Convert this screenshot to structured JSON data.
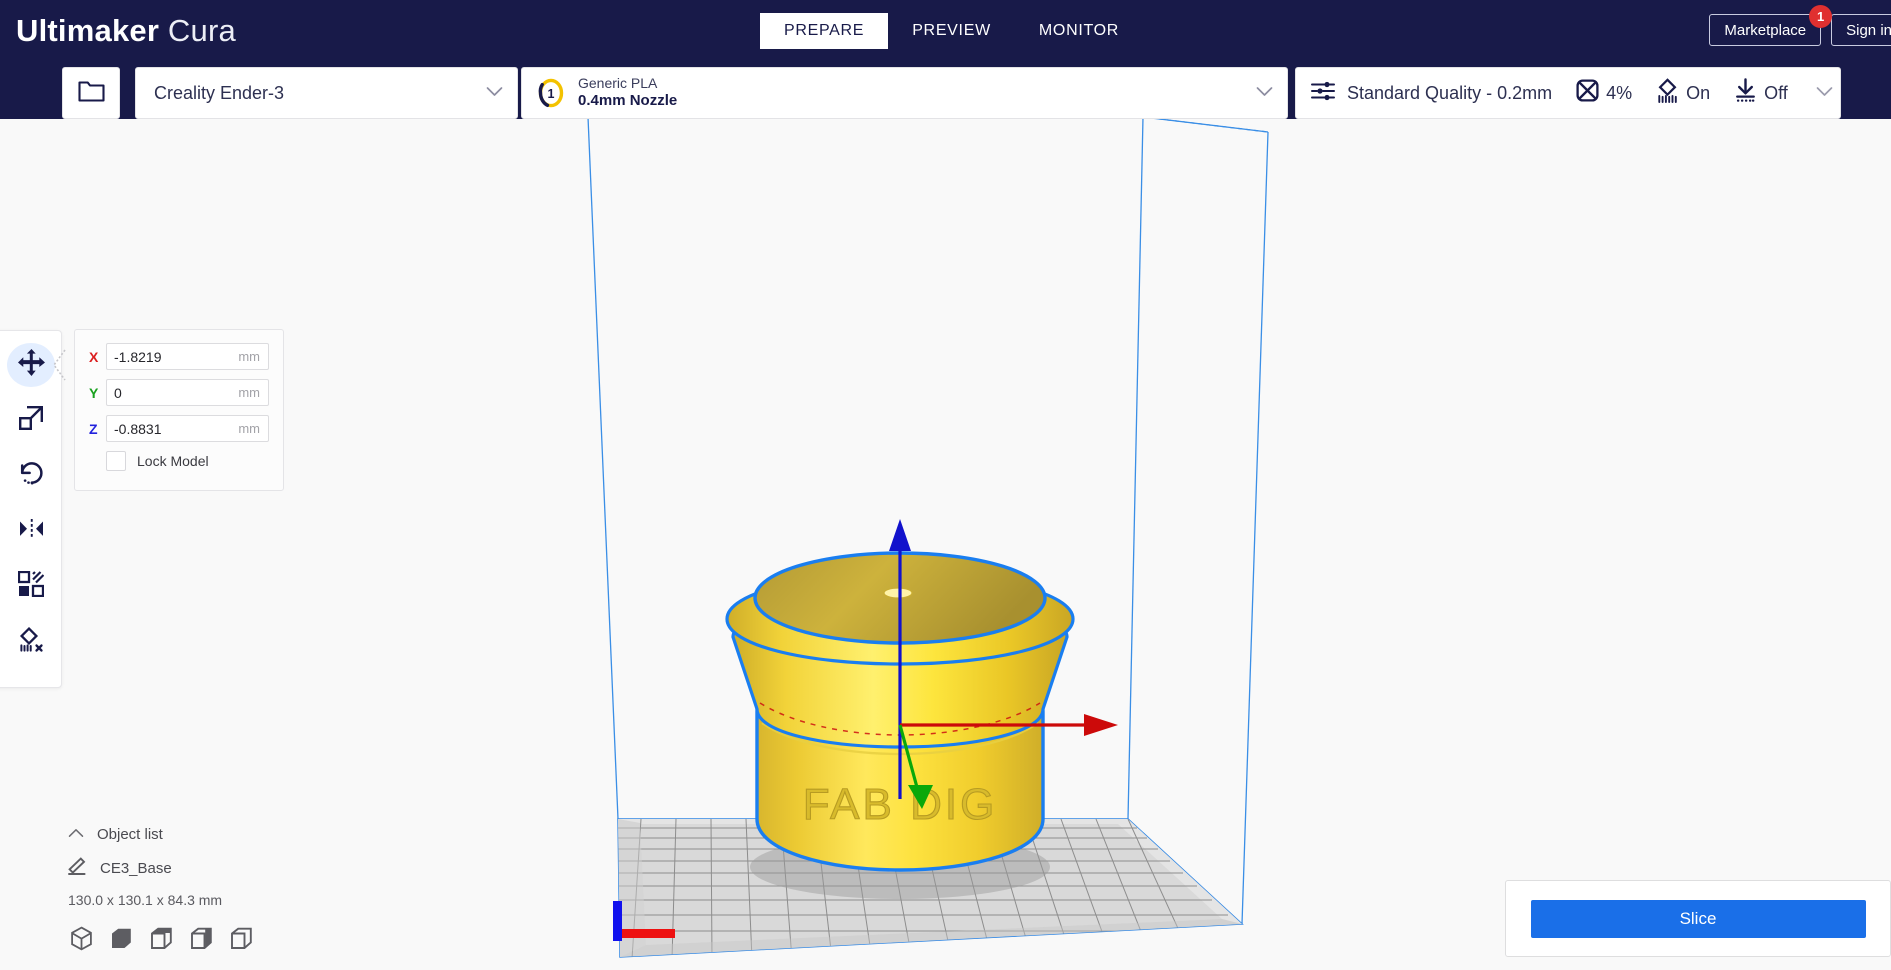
{
  "app": {
    "brand_bold": "Ultimaker",
    "brand_light": "Cura"
  },
  "header": {
    "tabs": [
      {
        "label": "PREPARE",
        "active": true
      },
      {
        "label": "PREVIEW",
        "active": false
      },
      {
        "label": "MONITOR",
        "active": false
      }
    ],
    "marketplace_label": "Marketplace",
    "marketplace_badge": "1",
    "signin_label": "Sign in"
  },
  "configbar": {
    "open_file_icon": "folder-icon",
    "machine": {
      "name": "Creality Ender-3",
      "chevron": "chevron-down-icon"
    },
    "material": {
      "extruder_number": "1",
      "name": "Generic PLA",
      "nozzle": "0.4mm Nozzle",
      "chevron": "chevron-down-icon"
    },
    "print_settings": {
      "profile_icon": "sliders-icon",
      "profile": "Standard Quality - 0.2mm",
      "infill_icon": "infill-icon",
      "infill": "4%",
      "support_icon": "support-icon",
      "support": "On",
      "adhesion_icon": "adhesion-icon",
      "adhesion": "Off",
      "chevron": "chevron-down-icon"
    }
  },
  "toolrail": {
    "tools": [
      {
        "name": "move-tool",
        "icon": "move-icon",
        "selected": true
      },
      {
        "name": "scale-tool",
        "icon": "scale-icon",
        "selected": false
      },
      {
        "name": "rotate-tool",
        "icon": "rotate-icon",
        "selected": false
      },
      {
        "name": "mirror-tool",
        "icon": "mirror-icon",
        "selected": false
      },
      {
        "name": "per-model-tool",
        "icon": "per-model-icon",
        "selected": false
      },
      {
        "name": "support-blocker",
        "icon": "support-blocker-icon",
        "selected": false
      }
    ]
  },
  "position_panel": {
    "x_label": "X",
    "x_value": "-1.8219",
    "y_label": "Y",
    "y_value": "0",
    "z_label": "Z",
    "z_value": "-0.8831",
    "unit": "mm",
    "lock_label": "Lock Model",
    "lock_checked": false
  },
  "object_list": {
    "collapse_icon": "chevron-up-icon",
    "title": "Object list",
    "edit_icon": "pencil-icon",
    "object_name": "CE3_Base",
    "dimensions": "130.0 x 130.1 x 84.3 mm",
    "view_icons": [
      "view-3d-icon",
      "view-front-icon",
      "view-top-icon",
      "view-left-icon",
      "view-right-icon"
    ]
  },
  "action_panel": {
    "slice_label": "Slice"
  },
  "viewport": {
    "model_label": "FAB DIG",
    "background_color": "#f9f9f9",
    "build_volume_color": "#3a8ee6",
    "model_color": "#f5d820",
    "selection_outline_color": "#1a7ef0",
    "axis_x_color": "#cc0000",
    "axis_y_color": "#00aa00",
    "axis_z_color": "#0000cc"
  },
  "colors": {
    "brand_dark": "#181a49",
    "accent_blue": "#1a6fe8",
    "badge_red": "#e03030",
    "extruder_yellow": "#f3c200"
  }
}
